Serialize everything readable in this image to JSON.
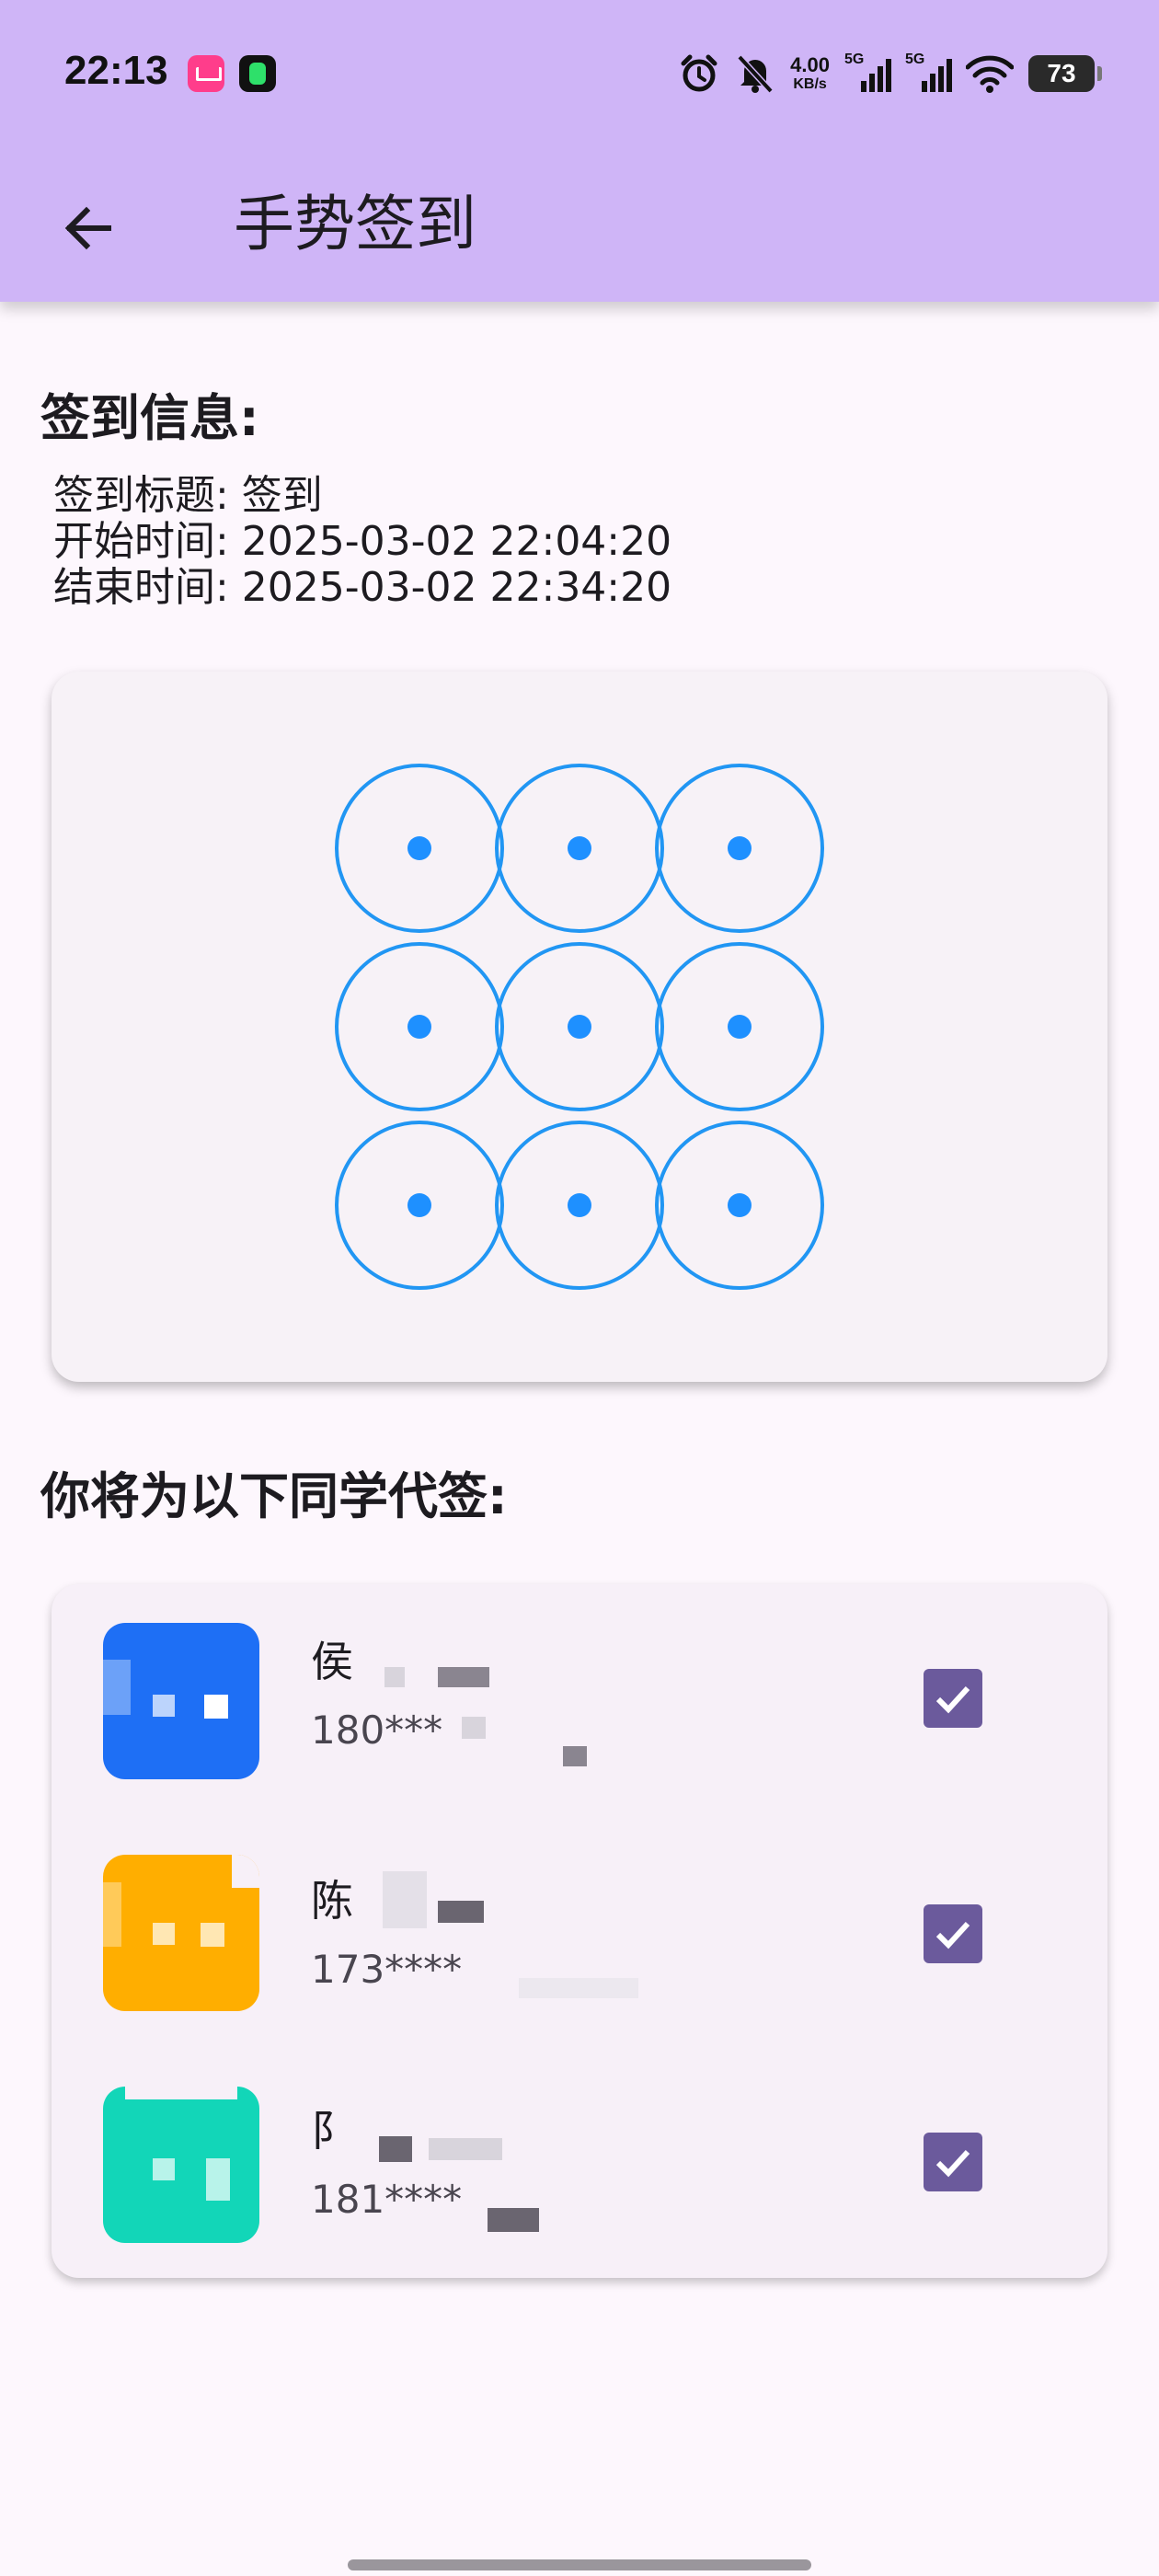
{
  "status_bar": {
    "time": "22:13",
    "net_speed_value": "4.00",
    "net_speed_unit": "KB/s",
    "sim1_label": "5G",
    "sim2_label": "5G",
    "battery": "73",
    "icons": [
      "alarm-icon",
      "mute-icon",
      "signal-icon",
      "signal-icon",
      "wifi-icon",
      "battery-icon"
    ]
  },
  "app_bar": {
    "title": "手势签到",
    "back_icon": "arrow-back-icon"
  },
  "info": {
    "heading": "签到信息:",
    "title_line": "签到标题: 签到",
    "start_line": "开始时间: 2025-03-02 22:04:20",
    "end_line": "结束时间: 2025-03-02 22:34:20"
  },
  "gesture_pad": {
    "rows": 3,
    "cols": 3,
    "ring_color": "#2196f3",
    "dot_color": "#1e90ff"
  },
  "proxy": {
    "heading": "你将为以下同学代签:",
    "students": [
      {
        "name": "侯",
        "phone": "180***",
        "checked": true,
        "avatar_color": "#1e6ff5"
      },
      {
        "name": "陈",
        "phone": "173****",
        "checked": true,
        "avatar_color": "#ffae00"
      },
      {
        "name": "阝",
        "phone": "181****",
        "checked": true,
        "avatar_color": "#12d6b8"
      }
    ]
  },
  "colors": {
    "app_bar": "#cfb5f7",
    "checkbox": "#6b5a9c",
    "background": "#fdf7fd"
  }
}
